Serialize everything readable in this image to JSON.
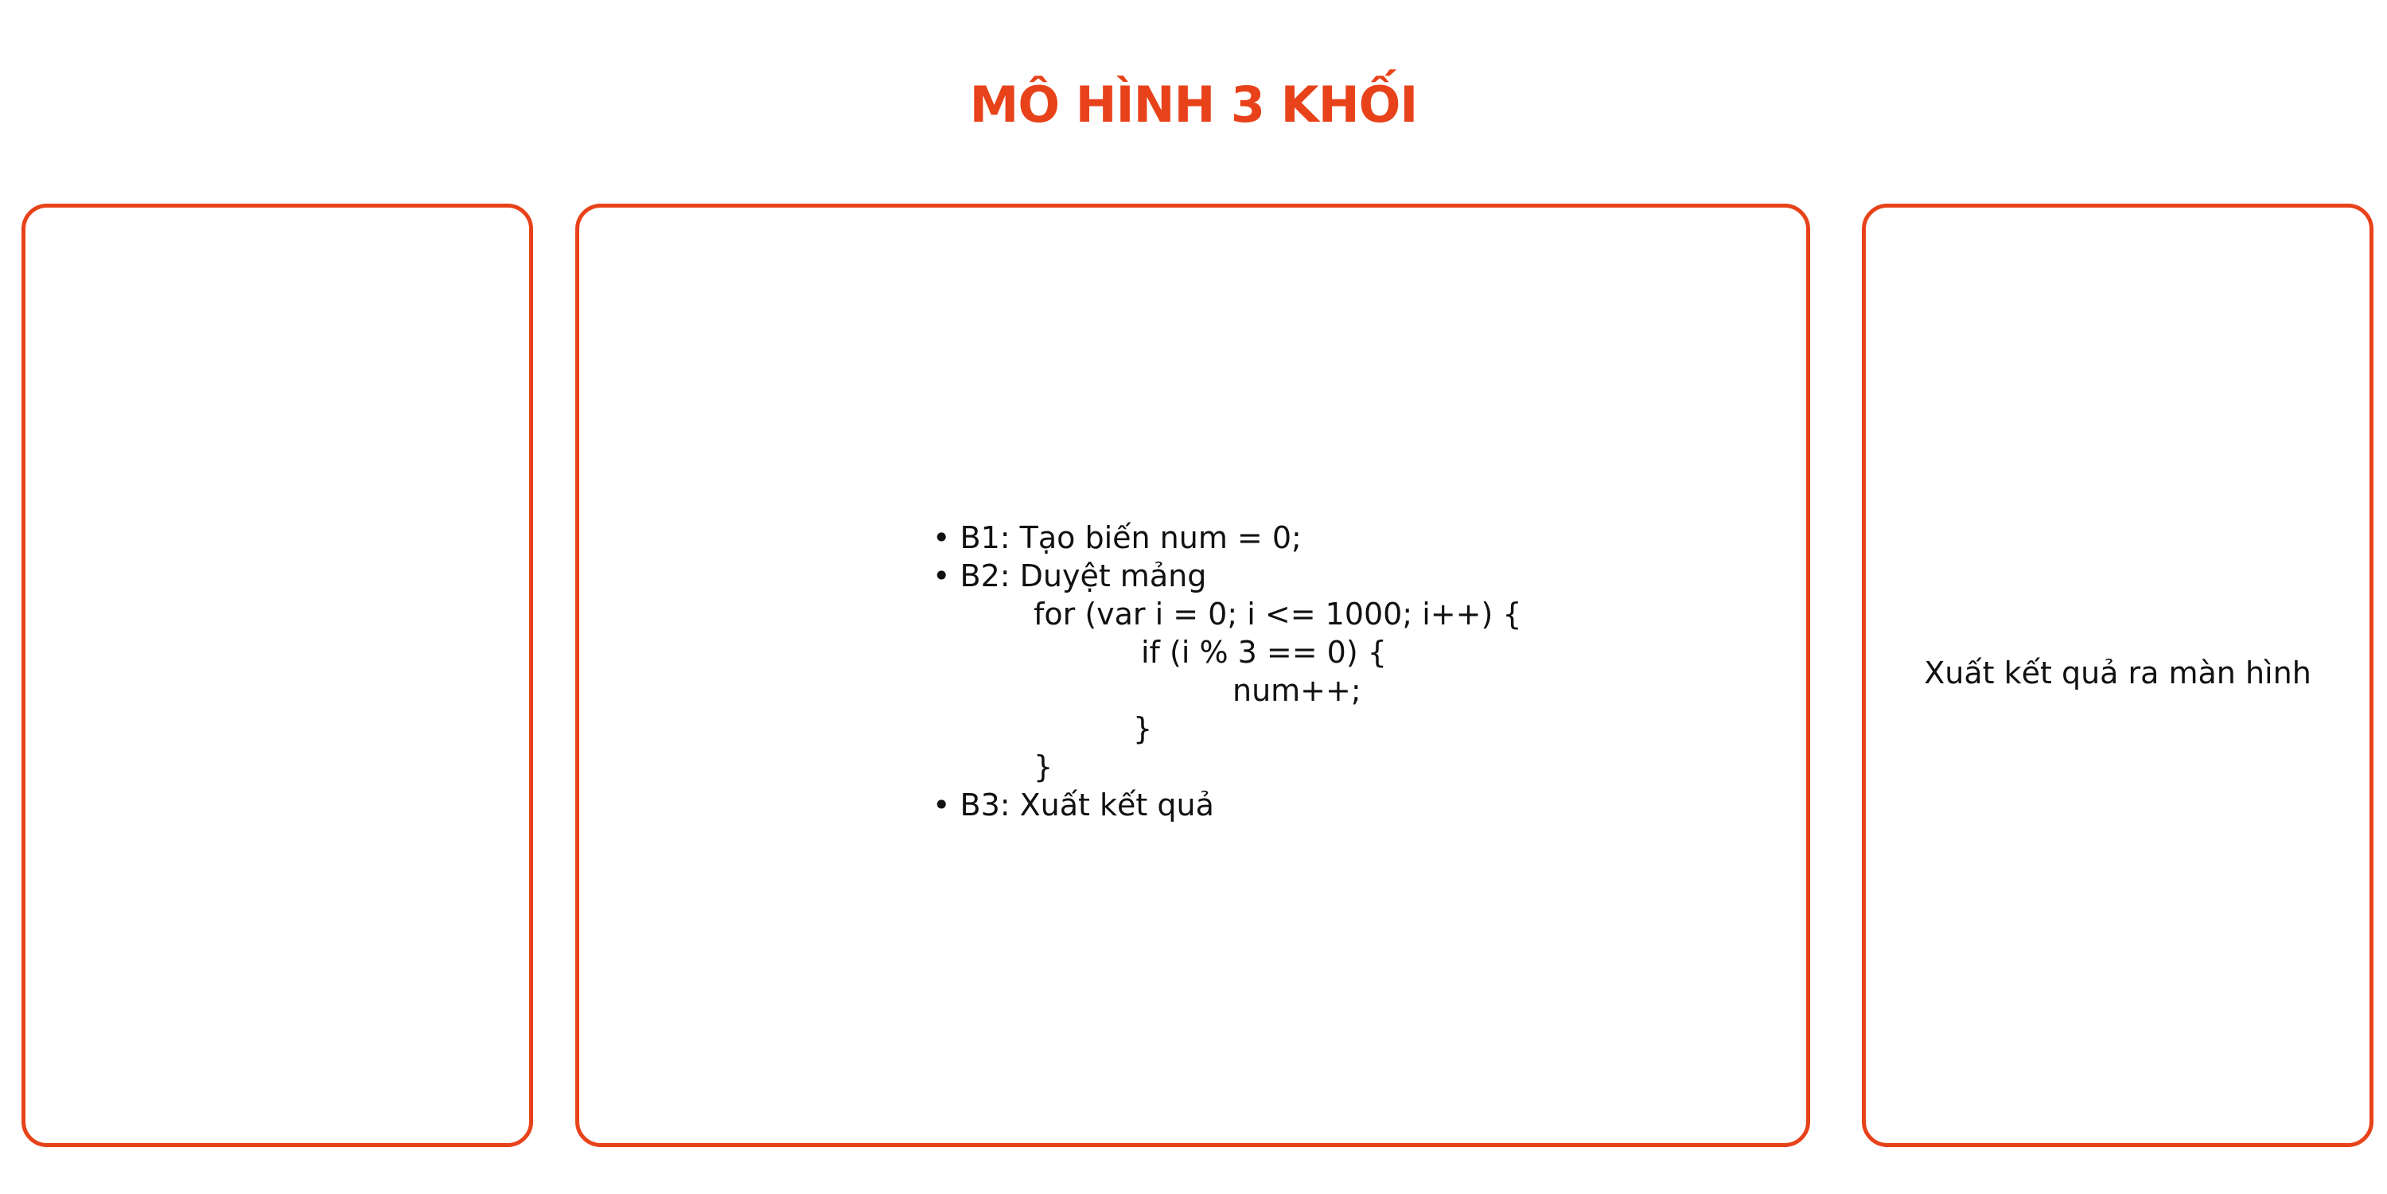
{
  "title": "MÔ HÌNH 3 KHỐI",
  "colors": {
    "accent": "#E8421A",
    "text": "#111111",
    "background": "#ffffff"
  },
  "blocks": {
    "input": {
      "text": ""
    },
    "process": {
      "lines": [
        "• B1: Tạo biến num = 0;",
        "• B2: Duyệt mảng",
        "for (var i = 0; i <= 1000; i++) {",
        "if (i % 3 == 0) {",
        "num++;",
        "}",
        "}",
        "• B3: Xuất kết quả"
      ]
    },
    "output": {
      "text": "Xuất kết quả ra màn hình"
    }
  }
}
